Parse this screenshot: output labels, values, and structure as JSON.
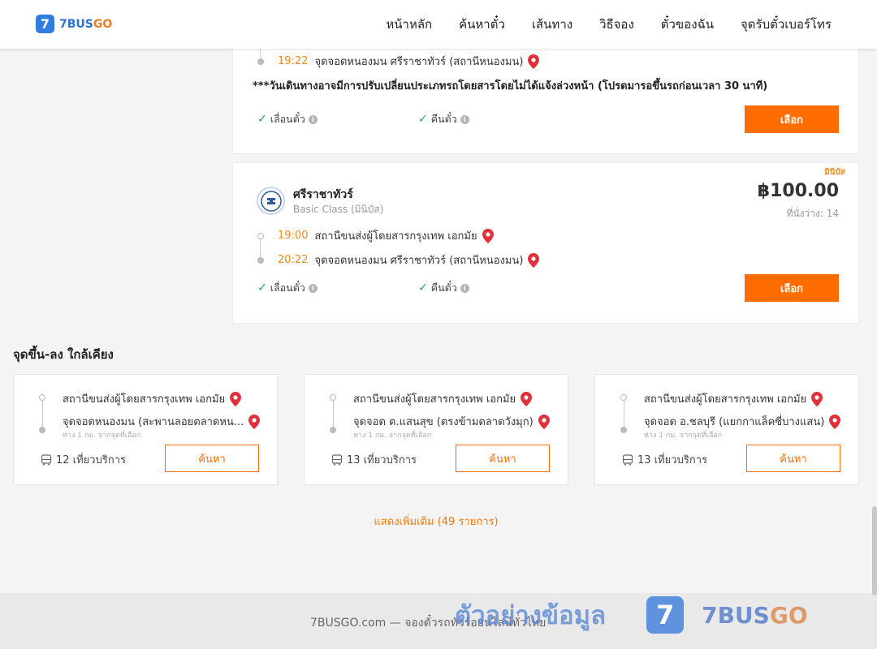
{
  "header": {
    "logo_mark": "7",
    "logo_blue": "7BUS",
    "logo_orange": "GO",
    "nav": [
      "หน้าหลัก",
      "ค้นหาตั๋ว",
      "เส้นทาง",
      "วิธีจอง",
      "ตั๋วของฉัน",
      "จุดรับตั๋วเบอร์โทร"
    ]
  },
  "card1": {
    "arrival_time": "19:22",
    "arrival_stop": "จุดจอดหนองมน ศรีราชาทัวร์ (สถานีหนองมน)",
    "notice": "***วันเดินทางอาจมีการปรับเปลี่ยนประเภทรถโดยสารโดยไม่ได้แจ้งล่วงหน้า (โปรดมารอขึ้นรถก่อนเวลา 30 นาที)",
    "feature_reschedule": "เลื่อนตั๋ว",
    "feature_refund": "คืนตั๋ว",
    "select_label": "เลือก"
  },
  "card2": {
    "bus_type": "มินิบัส",
    "operator": "ศรีราชาทัวร์",
    "class": "Basic Class (มินิบัส)",
    "price": "฿100.00",
    "seats": "ที่นั่งว่าง: 14",
    "depart_time": "19:00",
    "depart_stop": "สถานีขนส่งผู้โดยสารกรุงเทพ เอกมัย",
    "arrival_time": "20:22",
    "arrival_stop": "จุดจอดหนองมน ศรีราชาทัวร์ (สถานีหนองมน)",
    "feature_reschedule": "เลื่อนตั๋ว",
    "feature_refund": "คืนตั๋ว",
    "select_label": "เลือก"
  },
  "nearby": {
    "title": "จุดขึ้น-ลง ใกล้เคียง",
    "items": [
      {
        "from": "สถานีขนส่งผู้โดยสารกรุงเทพ เอกมัย",
        "to": "จุดจอดหนองมน (สะพานลอยตลาดหน...",
        "distance": "ห่าง 1 กม. จากจุดที่เลือก",
        "trips": "12 เที่ยวบริการ",
        "search": "ค้นหา"
      },
      {
        "from": "สถานีขนส่งผู้โดยสารกรุงเทพ เอกมัย",
        "to": "จุดจอด ต.แสนสุข (ตรงข้ามตลาดวังมุก)",
        "distance": "ห่าง 1 กม. จากจุดที่เลือก",
        "trips": "13 เที่ยวบริการ",
        "search": "ค้นหา"
      },
      {
        "from": "สถานีขนส่งผู้โดยสารกรุงเทพ เอกมัย",
        "to": "จุดจอด อ.ชลบุรี (แยกกาแล็คซี่บางแสน)",
        "distance": "ห่าง 1 กม. จากจุดที่เลือก",
        "trips": "13 เที่ยวบริการ",
        "search": "ค้นหา"
      }
    ],
    "show_more": "แสดงเพิ่มเติม (49 รายการ)"
  },
  "footer": {
    "text": "7BUSGO.com — จองตั๋วรถทัวร์ออนไลน์ทั่วไทย",
    "watermark_text": "ตัวอย่างข้อมูล",
    "watermark_mark": "7",
    "watermark_blue": "7BUS",
    "watermark_orange": "GO"
  },
  "colors": {
    "accent": "#ff6d00",
    "time": "#f08a1c",
    "brand_blue": "#2f7de1",
    "check": "#2ea84a"
  },
  "icons": [
    "map-pin-icon",
    "check-icon",
    "info-icon",
    "bus-icon",
    "operator-logo-icon"
  ]
}
